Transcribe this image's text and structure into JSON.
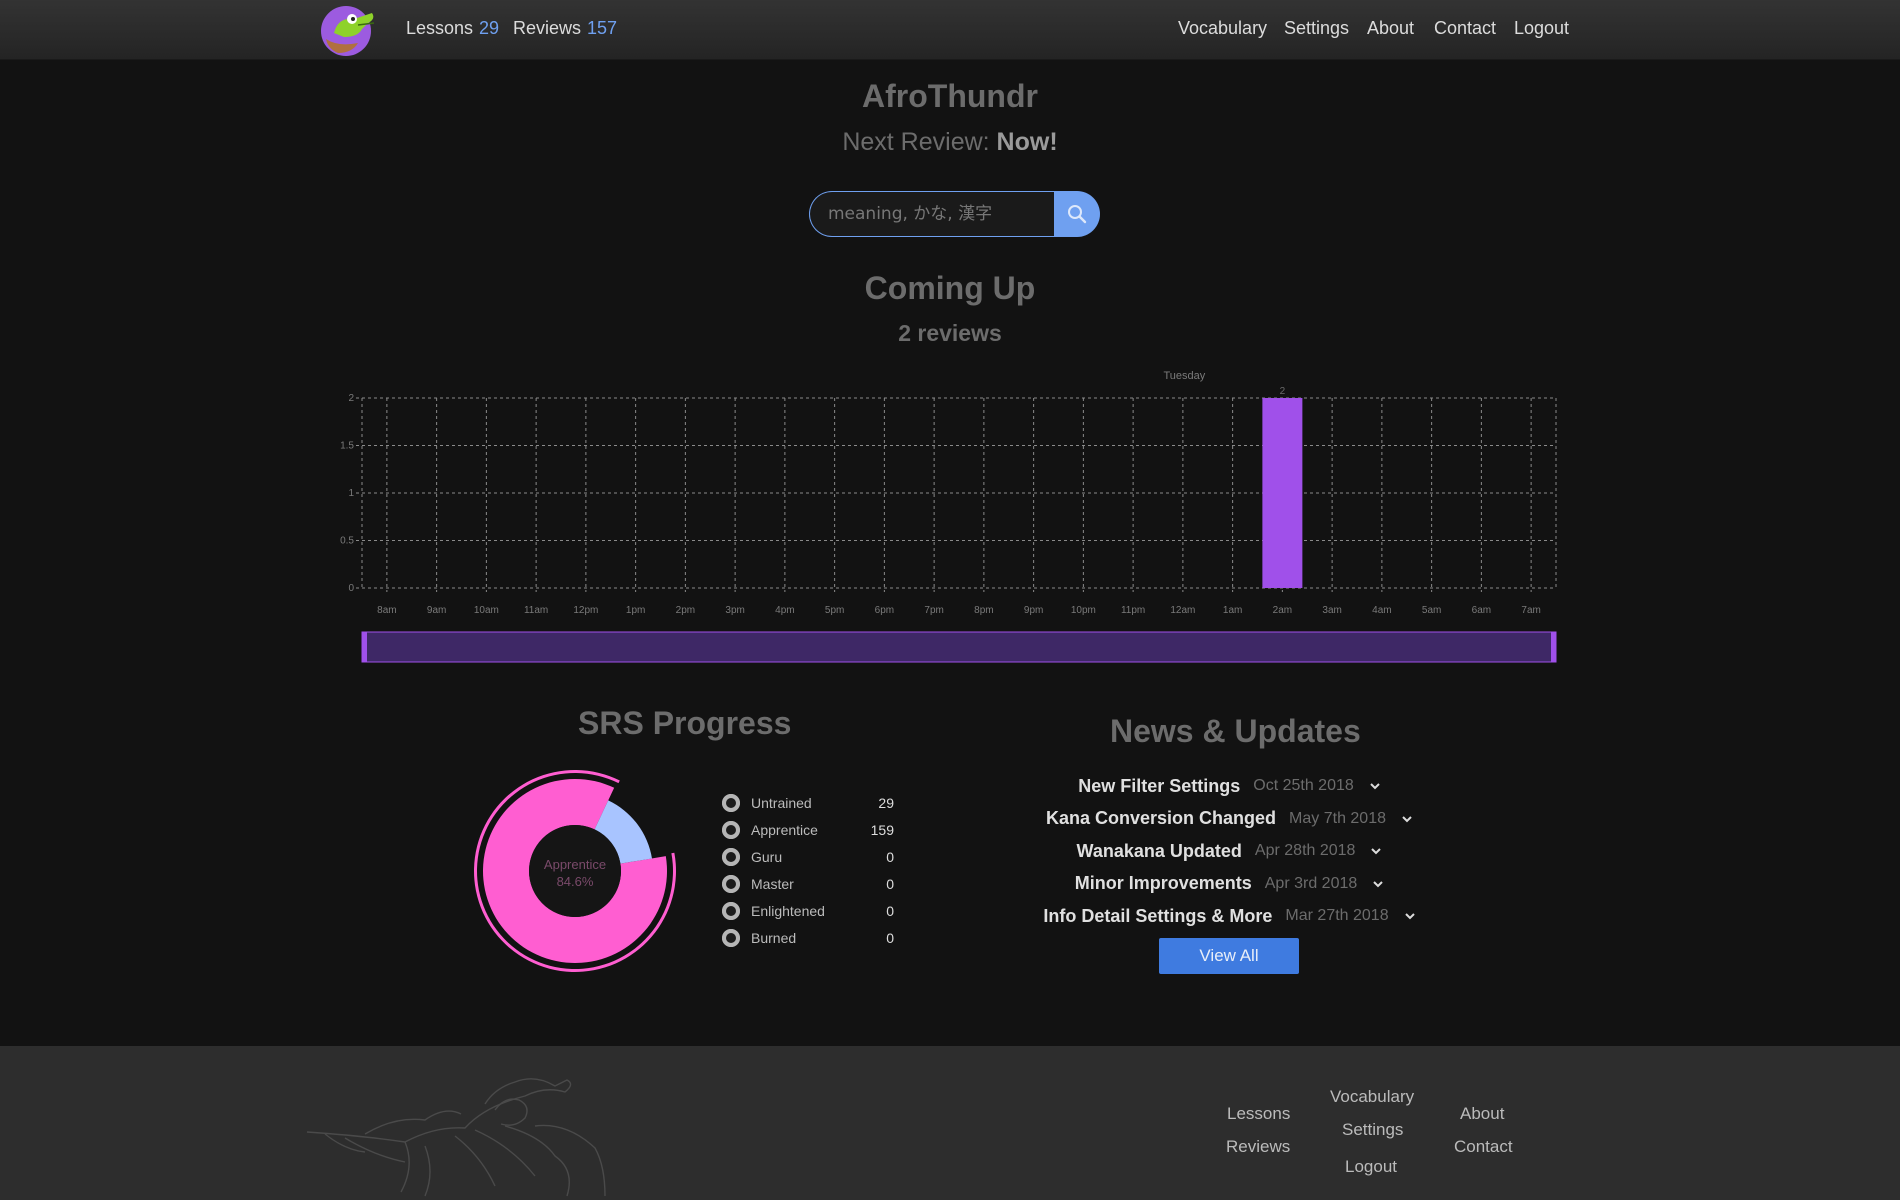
{
  "nav": {
    "lessons_label": "Lessons",
    "lessons_count": "29",
    "reviews_label": "Reviews",
    "reviews_count": "157",
    "right_links": [
      "Vocabulary",
      "Settings",
      "About",
      "Contact",
      "Logout"
    ]
  },
  "profile": {
    "username": "AfroThundr",
    "next_review_label": "Next Review:",
    "next_review_value": "Now!"
  },
  "search": {
    "placeholder": "meaning, かな, 漢字"
  },
  "upcoming": {
    "title": "Coming Up",
    "subtitle": "2 reviews"
  },
  "chart_data": {
    "type": "bar",
    "categories": [
      "8am",
      "9am",
      "10am",
      "11am",
      "12pm",
      "1pm",
      "2pm",
      "3pm",
      "4pm",
      "5pm",
      "6pm",
      "7pm",
      "8pm",
      "9pm",
      "10pm",
      "11pm",
      "12am",
      "1am",
      "2am",
      "3am",
      "4am",
      "5am",
      "6am",
      "7am"
    ],
    "values": [
      0,
      0,
      0,
      0,
      0,
      0,
      0,
      0,
      0,
      0,
      0,
      0,
      0,
      0,
      0,
      0,
      0,
      0,
      2,
      0,
      0,
      0,
      0,
      0
    ],
    "ylim": [
      0,
      2
    ],
    "yticks": [
      "0",
      "0.5",
      "1",
      "1.5",
      "2"
    ],
    "day_label": "Tuesday",
    "bar_label": "2",
    "grid": true,
    "color": "#a050ea"
  },
  "srs": {
    "title": "SRS Progress",
    "center_label": "Apprentice",
    "center_value": "84.6%",
    "items": [
      {
        "label": "Untrained",
        "count": "29"
      },
      {
        "label": "Apprentice",
        "count": "159"
      },
      {
        "label": "Guru",
        "count": "0"
      },
      {
        "label": "Master",
        "count": "0"
      },
      {
        "label": "Enlightened",
        "count": "0"
      },
      {
        "label": "Burned",
        "count": "0"
      }
    ],
    "colors": {
      "apprentice": "#ff5ed1",
      "untrained": "#a8c4ff"
    }
  },
  "news": {
    "title": "News & Updates",
    "items": [
      {
        "title": "New Filter Settings",
        "date": "Oct 25th 2018"
      },
      {
        "title": "Kana Conversion Changed",
        "date": "May 7th 2018"
      },
      {
        "title": "Wanakana Updated",
        "date": "Apr 28th 2018"
      },
      {
        "title": "Minor Improvements",
        "date": "Apr 3rd 2018"
      },
      {
        "title": "Info Detail Settings & More",
        "date": "Mar 27th 2018"
      }
    ],
    "view_all_label": "View All"
  },
  "footer": {
    "col1": [
      "Lessons",
      "Reviews"
    ],
    "col2": [
      "Vocabulary",
      "Settings",
      "Logout"
    ],
    "col3": [
      "About",
      "Contact"
    ]
  }
}
